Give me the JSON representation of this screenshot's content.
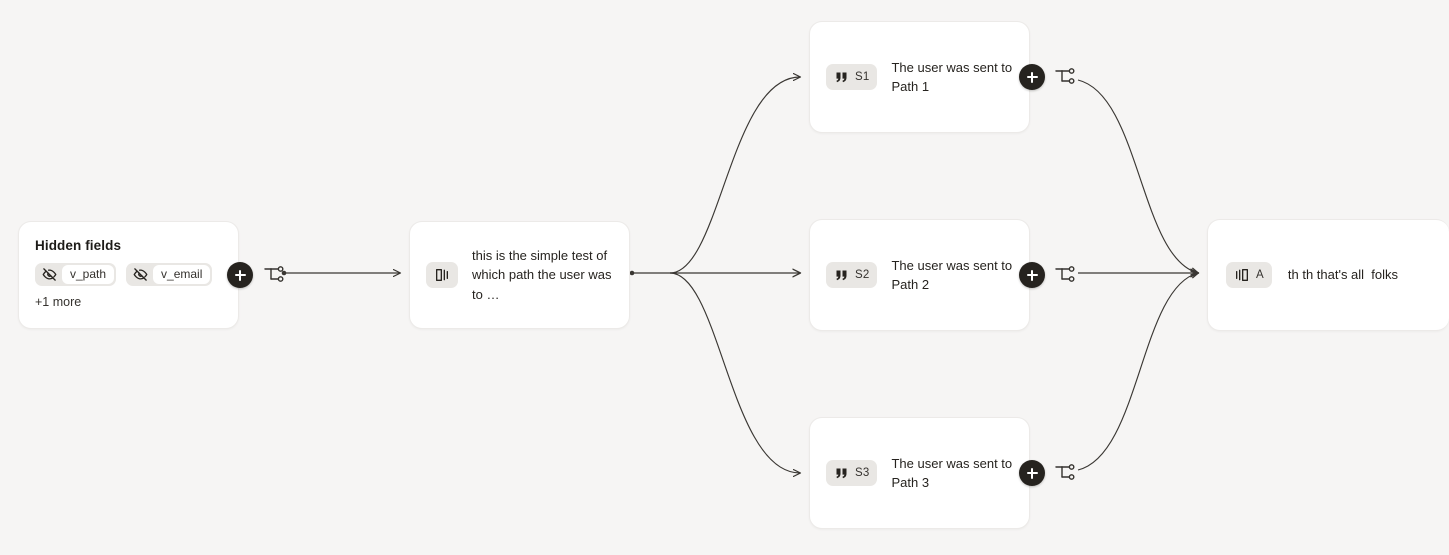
{
  "canvas": {
    "background_color": "#f6f5f4",
    "node_background_color": "#ffffff",
    "node_border_color": "#eceae8",
    "accent_color": "#26231f",
    "badge_background_color": "#e9e7e4",
    "edge_color": "#3a3733"
  },
  "nodes": {
    "hidden_fields": {
      "title": "Hidden fields",
      "chips": [
        {
          "icon": "eye-off-icon",
          "label": "v_path"
        },
        {
          "icon": "eye-off-icon",
          "label": "v_email"
        }
      ],
      "more_label": "+1 more"
    },
    "split": {
      "icon": "split-branch-icon",
      "text": "this is the simple test of which path the user was to …"
    },
    "paths": [
      {
        "icon": "quote-icon",
        "badge": "S1",
        "text": "The user was sent to Path 1"
      },
      {
        "icon": "quote-icon",
        "badge": "S2",
        "text": "The user was sent to Path 2"
      },
      {
        "icon": "quote-icon",
        "badge": "S3",
        "text": "The user was sent to Path 3"
      }
    ],
    "end": {
      "icon": "merge-branch-icon",
      "badge": "A",
      "text": "th th that's all  folks"
    }
  },
  "controls": {
    "add_step_label": "+",
    "branch_icon": "branch-icon"
  }
}
